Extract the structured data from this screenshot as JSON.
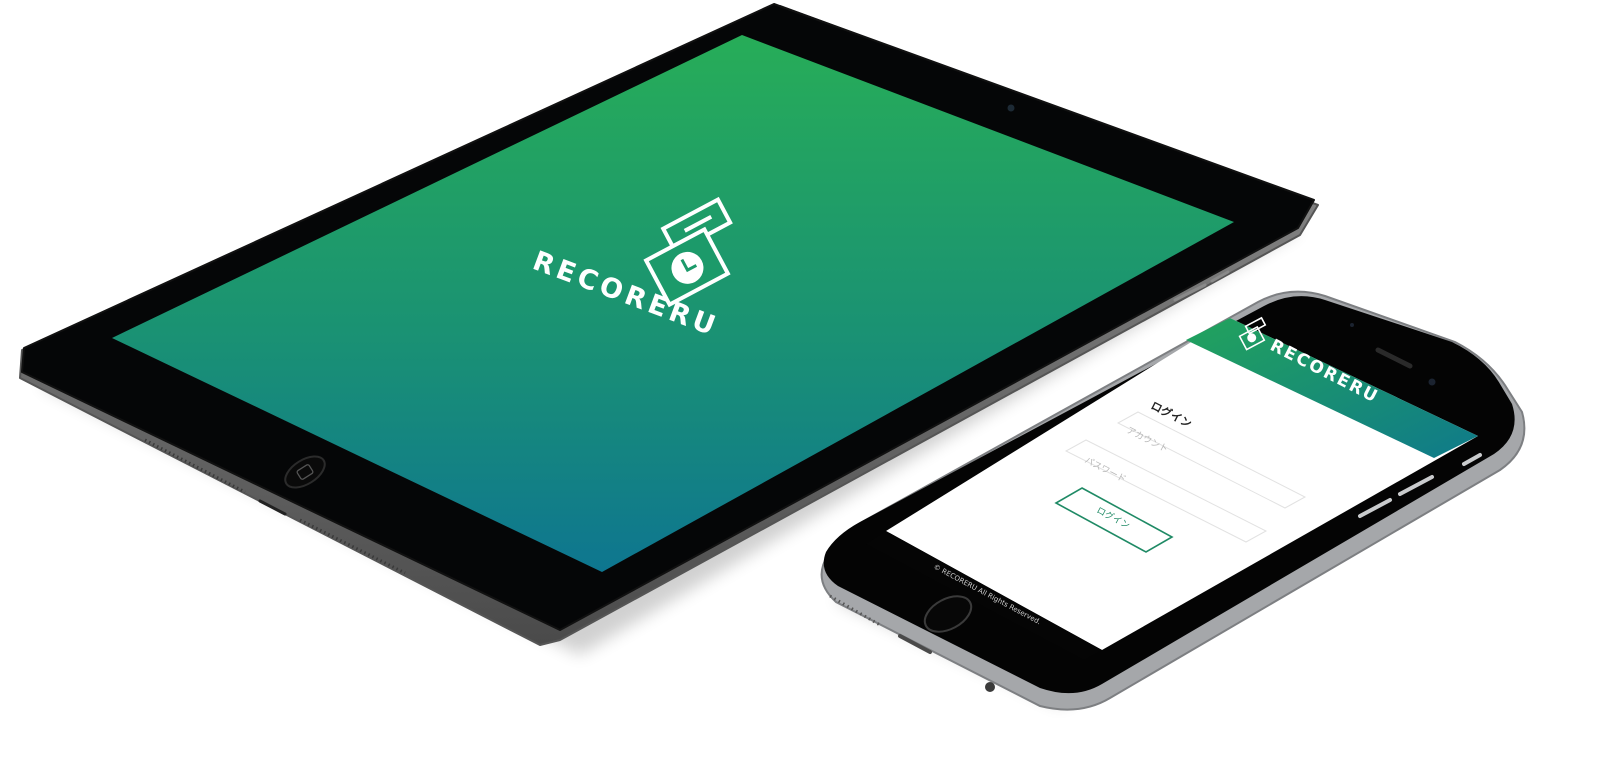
{
  "tablet": {
    "logo_text": "RECORERU"
  },
  "phone": {
    "header_logo_text": "RECORERU",
    "login_title": "ログイン",
    "account_placeholder": "アカウント",
    "password_placeholder": "パスワード",
    "login_button_label": "ログイン",
    "footer_text": "© RECORERU All Rights Reserved."
  },
  "colors": {
    "brand_green": "#25ac5a",
    "brand_teal": "#0f7a8e",
    "button_outline": "#1f8a65"
  }
}
